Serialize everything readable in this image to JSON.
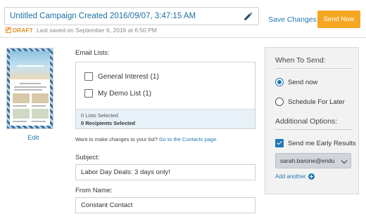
{
  "header": {
    "campaign_title": "Untitled Campaign Created 2016/09/07, 3:47:15 AM",
    "draft_label": "DRAFT",
    "last_saved": "Last saved on September 6, 2016 at 6:50 PM",
    "save_changes_label": "Save Changes",
    "send_now_label": "Send Now",
    "accent_color": "#f5a623",
    "link_color": "#1f78b4"
  },
  "preview": {
    "edit_label": "Edit"
  },
  "email_lists": {
    "label": "Email Lists:",
    "items": [
      {
        "label": "General Interest (1)",
        "checked": false
      },
      {
        "label": "My Demo List (1)",
        "checked": false
      }
    ],
    "lists_selected": "0 Lists Selected",
    "recipients_selected": "0 Recipients Selected",
    "help_text": "Want to make changes to your list?",
    "help_link": "Go to the Contacts page."
  },
  "subject": {
    "label": "Subject:",
    "value": "Labor Day Deals: 3 days only!"
  },
  "from_name": {
    "label": "From Name:",
    "value": "Constant Contact"
  },
  "send_panel": {
    "when_heading": "When To Send:",
    "send_now_option": "Send now",
    "schedule_option": "Schedule For Later",
    "selected_option": "Send now",
    "additional_heading": "Additional Options:",
    "early_results_label": "Send me Early Results",
    "early_results_checked": true,
    "early_results_email": "sarah.barone@endu",
    "add_another_label": "Add another"
  }
}
